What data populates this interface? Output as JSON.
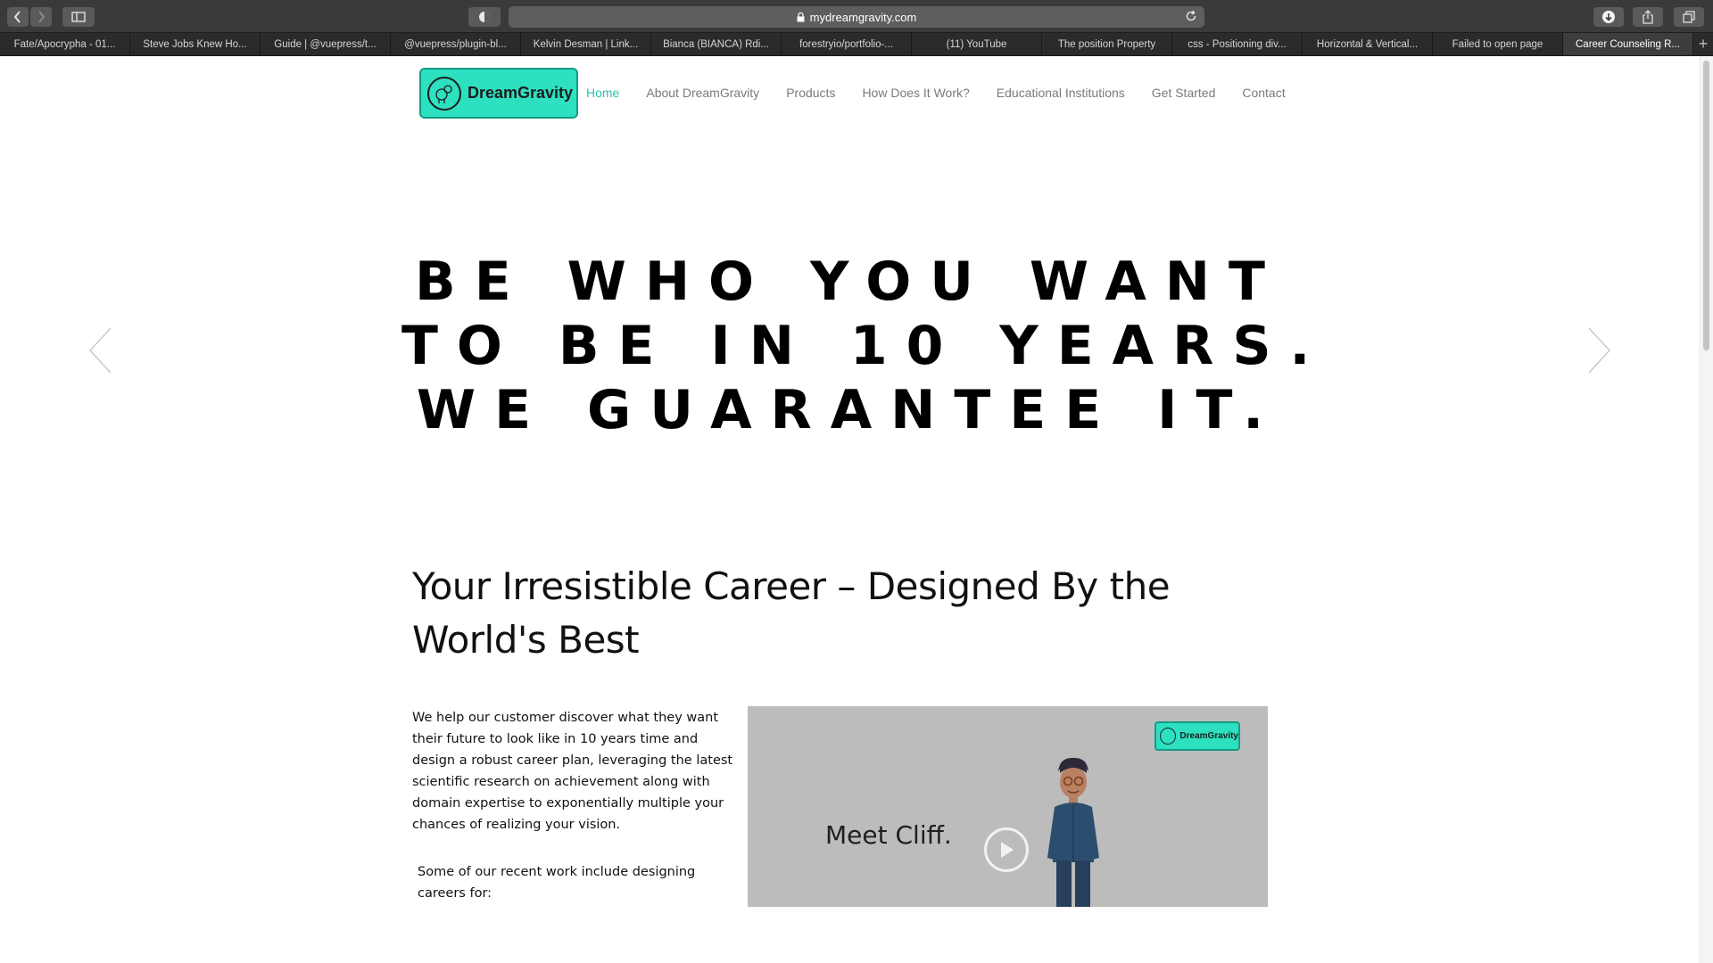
{
  "browser": {
    "url": "mydreamgravity.com",
    "tabs": [
      "Fate/Apocrypha - 01...",
      "Steve Jobs Knew Ho...",
      "Guide | @vuepress/t...",
      "@vuepress/plugin-bl...",
      "Kelvin Desman | Link...",
      "Bianca (BIANCA) Rdi...",
      "forestryio/portfolio-...",
      "(11) YouTube",
      "The position Property",
      "css - Positioning div...",
      "Horizontal & Vertical...",
      "Failed to open page",
      "Career Counseling R..."
    ],
    "active_tab_index": 12,
    "new_tab_label": "+"
  },
  "site": {
    "brand": "DreamGravity",
    "nav": [
      {
        "label": "Home",
        "active": true
      },
      {
        "label": "About DreamGravity",
        "active": false
      },
      {
        "label": "Products",
        "active": false
      },
      {
        "label": "How Does It Work?",
        "active": false
      },
      {
        "label": "Educational Institutions",
        "active": false
      },
      {
        "label": "Get Started",
        "active": false
      },
      {
        "label": "Contact",
        "active": false
      }
    ],
    "accent_color": "#2de0c0",
    "nav_active_color": "#28c2b0"
  },
  "hero": {
    "lines": [
      "BE WHO YOU WANT",
      "TO BE IN 10 YEARS.",
      "WE GUARANTEE IT."
    ],
    "prev_icon": "chevron-left-icon",
    "next_icon": "chevron-right-icon"
  },
  "content": {
    "headline_line1": "Your Irresistible Career – Designed By the",
    "headline_line2": "World's Best",
    "paragraph": "We help our customer discover what they want their future to look like in 10 years time and design a robust career plan, leveraging the latest scientific research on achievement along with domain expertise to exponentially multiple your chances of realizing your vision.",
    "paragraph2": "Some of our recent work include designing careers for:"
  },
  "video": {
    "caption": "Meet Cliff.",
    "brand": "DreamGravity",
    "play_icon": "play-icon"
  }
}
